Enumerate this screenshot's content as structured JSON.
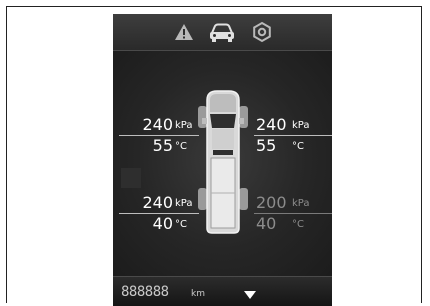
{
  "tabs": [
    {
      "icon": "warning-icon",
      "active": false
    },
    {
      "icon": "car-icon",
      "active": true
    },
    {
      "icon": "settings-icon",
      "active": false
    }
  ],
  "tires": {
    "front_left": {
      "pressure": "240",
      "pressure_unit": "kPa",
      "temperature": "55",
      "temperature_unit": "°C"
    },
    "front_right": {
      "pressure": "240",
      "pressure_unit": "kPa",
      "temperature": "55",
      "temperature_unit": "°C"
    },
    "rear_left": {
      "pressure": "240",
      "pressure_unit": "kPa",
      "temperature": "40",
      "temperature_unit": "°C"
    },
    "rear_right": {
      "pressure": "200",
      "pressure_unit": "kPa",
      "temperature": "40",
      "temperature_unit": "°C",
      "dimmed": true
    }
  },
  "odometer": {
    "value": "888888",
    "unit": "km"
  },
  "navigation": {
    "icon": "chevron-down-icon"
  },
  "colors": {
    "screen_bg": "#1b1b1b",
    "text_active": "#ffffff",
    "text_dimmed": "#8c8c8c",
    "icon": "#cfcfcf"
  }
}
